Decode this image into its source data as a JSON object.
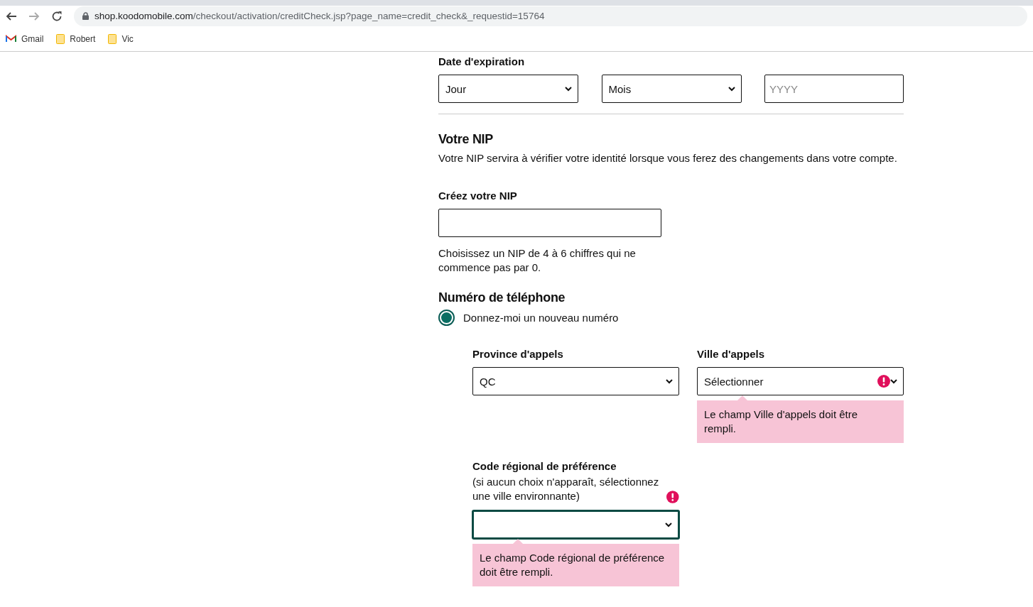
{
  "browser": {
    "url_host": "shop.koodomobile.com",
    "url_path": "/checkout/activation/creditCheck.jsp?page_name=credit_check&_requestid=15764",
    "bookmarks": [
      {
        "label": "Gmail",
        "kind": "gmail"
      },
      {
        "label": "Robert",
        "kind": "folder"
      },
      {
        "label": "Vic",
        "kind": "folder"
      }
    ]
  },
  "expiration": {
    "label": "Date d'expiration",
    "day": "Jour",
    "month": "Mois",
    "year_placeholder": "YYYY"
  },
  "pin": {
    "heading": "Votre NIP",
    "description": "Votre NIP servira à vérifier votre identité lorsque vous ferez des changements dans votre compte.",
    "create_label": "Créez votre NIP",
    "hint": "Choisissez un NIP de 4 à 6 chiffres qui ne commence pas par 0."
  },
  "phone": {
    "heading": "Numéro de téléphone",
    "options": [
      {
        "label": "Donnez-moi un nouveau numéro",
        "selected": true
      }
    ],
    "province": {
      "label": "Province d'appels",
      "value": "QC",
      "invalid": false
    },
    "city": {
      "label": "Ville d'appels",
      "value": "Sélectionner",
      "invalid": true,
      "error": "Le champ Ville d'appels doit être rempli."
    },
    "area_code": {
      "label": "Code régional de préférence",
      "note": "(si aucun choix n'apparaît, sélectionnez une ville environnante)",
      "invalid": true,
      "focused": true,
      "error": "Le champ Code régional de préférence doit être rempli."
    }
  }
}
